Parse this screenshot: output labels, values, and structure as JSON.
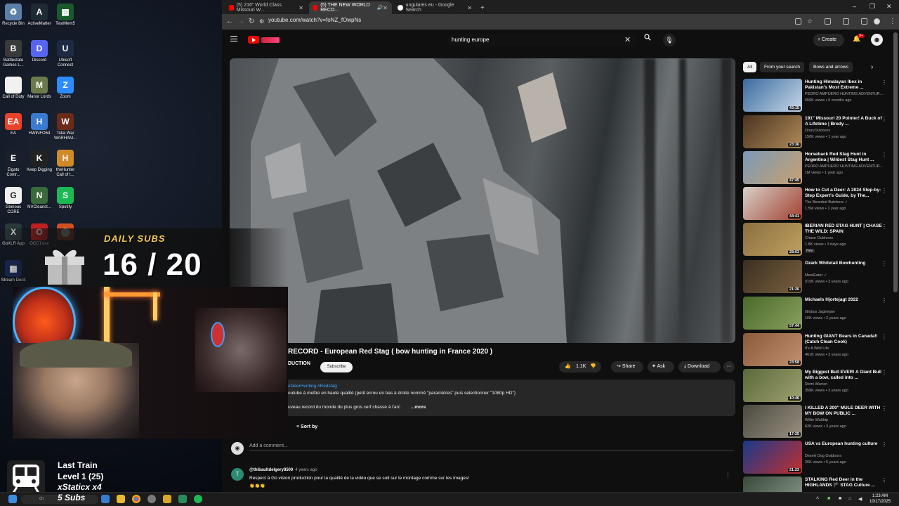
{
  "desktop": {
    "icons": [
      {
        "label": "Recycle Bin",
        "color": "#5b7fa8",
        "glyph": "♻"
      },
      {
        "label": "ActiveMatter",
        "color": "#1f2a33",
        "glyph": "A"
      },
      {
        "label": "TestMem5",
        "color": "#1a5a2a",
        "glyph": "▦"
      },
      {
        "label": "Battlestate Games L...",
        "color": "#3a3a3a",
        "glyph": "B"
      },
      {
        "label": "Discord",
        "color": "#5865f2",
        "glyph": "D"
      },
      {
        "label": "Ubisoft Connect",
        "color": "#1e2a44",
        "glyph": "U"
      },
      {
        "label": "Call of Duty",
        "color": "#f1f1f1",
        "glyph": ""
      },
      {
        "label": "Manor Lords",
        "color": "#6a7a4a",
        "glyph": "M"
      },
      {
        "label": "Zoom",
        "color": "#2d8cff",
        "glyph": "Z"
      },
      {
        "label": "EA",
        "color": "#e8422b",
        "glyph": "EA"
      },
      {
        "label": "HWiNFO64",
        "color": "#3a7ad0",
        "glyph": "H"
      },
      {
        "label": "Total War WARHAM...",
        "color": "#6b2a1a",
        "glyph": "W"
      },
      {
        "label": "Elgato Contr...",
        "color": "#1a1f2a",
        "glyph": "E"
      },
      {
        "label": "Keep Digging",
        "color": "#222222",
        "glyph": "K"
      },
      {
        "label": "theHunter Call of t...",
        "color": "#d08a2a",
        "glyph": "H"
      },
      {
        "label": "Glorious CORE",
        "color": "#f0f0f0",
        "glyph": "G"
      },
      {
        "label": "NVCleanst...",
        "color": "#3a6a3a",
        "glyph": "N"
      },
      {
        "label": "Spotify",
        "color": "#1db954",
        "glyph": "S"
      },
      {
        "label": "GoXLR App",
        "color": "#2a3a3a",
        "glyph": "X"
      },
      {
        "label": "OCCT.exe",
        "color": "#c02020",
        "glyph": "O"
      },
      {
        "label": "",
        "color": "#d05020",
        "glyph": "⬤"
      },
      {
        "label": "Stream Deck",
        "color": "#1a2a5a",
        "glyph": "▦"
      }
    ]
  },
  "browser": {
    "tabs": [
      {
        "title": "(5) 216\" World Class Missouri W...",
        "active": false,
        "fav_color": "#ff0000"
      },
      {
        "title": "(5) THE NEW WORLD RECO...",
        "active": true,
        "fav_color": "#ff0000"
      },
      {
        "title": "ungulates eu - Google Search",
        "active": false,
        "fav_color": "#ffffff"
      }
    ],
    "new_tab": "+",
    "url": "youtube.com/watch?v=foNZ_fOwpNs",
    "window_controls": [
      "–",
      "❐",
      "✕"
    ]
  },
  "youtube": {
    "search_value": "hunting europe",
    "search_clear": "✕",
    "create_label": "+ Create",
    "bell_badge": "9+",
    "avatar_letter": "◉",
    "video": {
      "title": "RECORD - European Red Stag ( bow hunting in France 2020 )",
      "channel": "DUCTION",
      "subscribe": "Subscribe",
      "likes": "1.1K",
      "share": "Share",
      "ask": "Ask",
      "download": "Download",
      "more": "···"
    },
    "description": {
      "hashtags": "#DeerHunting #Redstag",
      "line1": "outube à mettre en haute qualité (petit ecrou en bas à droite nommé \"paramètres\" puis selectionner \"1080p HD\")",
      "line2": "uveau record du monde du plus gros cerf chassé à l'arc",
      "more": "...more"
    },
    "sort_by": "Sort by",
    "add_comment": "Add a comment...",
    "comment": {
      "avatar": "T",
      "author": "@thibaultdelgery8500",
      "time": "4 years ago",
      "text": "Respect à Go vision production pour la qualité de la vidéo que se soit sur le montage comme sur les images!",
      "emoji": "👏👏👏"
    },
    "chips": [
      "All",
      "From your search",
      "Bows and arrows",
      "›"
    ],
    "recommendations": [
      {
        "title": "Hunting Himalayan Ibex in Pakistan's Most Extreme ...",
        "channel": "PEDRO AMPUERO HUNTING ADVENTUR...",
        "meta": "650K views • 6 months ago",
        "duration": "43:15",
        "c1": "#3a6ba0",
        "c2": "#c8d8e8",
        "new": ""
      },
      {
        "title": "191\" Missouri 20 Pointer! A Buck of A Lifetime | Brody ...",
        "channel": "DruryOutdoors",
        "meta": "150K views • 1 year ago",
        "duration": "23:36",
        "c1": "#4a3420",
        "c2": "#b08a5a",
        "new": ""
      },
      {
        "title": "Horseback Red Stag Hunt in Argentina | Wildest Stag Hunt ...",
        "channel": "PEDRO AMPUERO HUNTING ADVENTUR...",
        "meta": "1M views • 1 year ago",
        "duration": "47:45",
        "c1": "#7a9ab8",
        "c2": "#c8a070",
        "new": ""
      },
      {
        "title": "How to Cut a Deer: A 2024 Step-by-Step Expert's Guide, by The...",
        "channel": "The Bearded Butchers ✓",
        "meta": "1.5M views • 1 year ago",
        "duration": "44:41",
        "c1": "#d8d0c8",
        "c2": "#a04030",
        "new": ""
      },
      {
        "title": "IBERIAN RED STAG HUNT | CHASE THE WILD: SPAIN",
        "channel": "Chase Outdoors",
        "meta": "1.8K views • 3 days ago",
        "duration": "28:03",
        "c1": "#8a7040",
        "c2": "#c0a060",
        "new": "New"
      },
      {
        "title": "Ozark Whitetail Bowhunting",
        "channel": "MeatEater ✓",
        "meta": "315K views • 3 years ago",
        "duration": "21:26",
        "c1": "#3a3020",
        "c2": "#7a6040",
        "new": ""
      },
      {
        "title": "Michaels Hjortejagt 2022",
        "channel": "Globus Jagtrejser",
        "meta": "16K views • 2 years ago",
        "duration": "57:44",
        "c1": "#4a6a2a",
        "c2": "#8aa060",
        "new": ""
      },
      {
        "title": "Hunting GIANT Bears in Canada!! (Catch Clean Cook)",
        "channel": "It's A Wild Life",
        "meta": "461K views • 3 years ago",
        "duration": "23:58",
        "c1": "#8a5a3a",
        "c2": "#c09070",
        "new": ""
      },
      {
        "title": "My Biggest Bull EVER! A Giant Bull with a bow, called into ...",
        "channel": "Remi Warren",
        "meta": "358K views • 3 years ago",
        "duration": "10:46",
        "c1": "#5a6a3a",
        "c2": "#a0a070",
        "new": ""
      },
      {
        "title": "I KILLED A 200\" MULE DEER WITH MY BOW ON PUBLIC ...",
        "channel": "Willie Waldrip",
        "meta": "62K views • 3 years ago",
        "duration": "17:25",
        "c1": "#4a4a40",
        "c2": "#9a9080",
        "new": ""
      },
      {
        "title": "USA vs European hunting culture",
        "channel": "Desert Dog Outdoors",
        "meta": "26K views • 5 years ago",
        "duration": "21:23",
        "c1": "#1a3a8a",
        "c2": "#c03030",
        "new": ""
      },
      {
        "title": "STALKING Red Deer in the HIGHLANDS 🏴 STAG Culture ...",
        "channel": "",
        "meta": "",
        "duration": "",
        "c1": "#3a4a3a",
        "c2": "#8a9a8a",
        "new": ""
      }
    ]
  },
  "overlay": {
    "subs_label": "DAILY SUBS",
    "subs_count": "16 / 20",
    "train_name": "Last Train",
    "train_level": "Level 1  (25)",
    "train_mult": "xStaticx x4",
    "subs_small": "5 Subs"
  },
  "taskbar": {
    "time": "1:23 AM",
    "date": "10/17/2025",
    "search_text": "ch"
  },
  "colors": {
    "yt_red": "#ff0000",
    "background": "#0f0f0f",
    "link_blue": "#3ea6ff",
    "daily_subs_gold": "#f2c94c"
  }
}
